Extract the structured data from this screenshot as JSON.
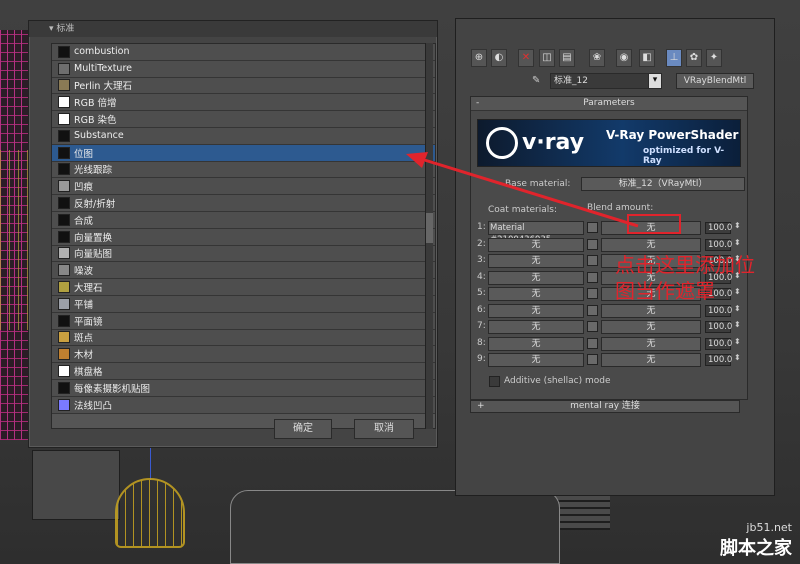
{
  "browser": {
    "title": "标准",
    "items": [
      {
        "label": "combustion",
        "thumb": "#111111"
      },
      {
        "label": "MultiTexture",
        "thumb": "#6e6e6e"
      },
      {
        "label": "Perlin 大理石",
        "thumb": "#8a7a55"
      },
      {
        "label": "RGB 倍增",
        "thumb": "#ffffff"
      },
      {
        "label": "RGB 染色",
        "thumb": "#ffffff"
      },
      {
        "label": "Substance",
        "thumb": "#111111"
      },
      {
        "label": "位图",
        "thumb": "#111111",
        "selected": true
      },
      {
        "label": "光线跟踪",
        "thumb": "#111111"
      },
      {
        "label": "凹痕",
        "thumb": "#9a9a9a"
      },
      {
        "label": "反射/折射",
        "thumb": "#111111"
      },
      {
        "label": "合成",
        "thumb": "#111111"
      },
      {
        "label": "向量置换",
        "thumb": "#111111"
      },
      {
        "label": "向量贴图",
        "thumb": "#b0b0b0"
      },
      {
        "label": "噪波",
        "thumb": "#888888"
      },
      {
        "label": "大理石",
        "thumb": "#b0a040"
      },
      {
        "label": "平铺",
        "thumb": "#9ca0a8"
      },
      {
        "label": "平面镜",
        "thumb": "#111111"
      },
      {
        "label": "斑点",
        "thumb": "#caa040"
      },
      {
        "label": "木材",
        "thumb": "#c08030"
      },
      {
        "label": "棋盘格",
        "thumb": "#ffffff"
      },
      {
        "label": "每像素摄影机贴图",
        "thumb": "#111111"
      },
      {
        "label": "法线凹凸",
        "thumb": "#7a7aff"
      }
    ],
    "ok_label": "确定",
    "cancel_label": "取消"
  },
  "material": {
    "name": "标准_12",
    "type_button": "VRayBlendMtl",
    "rollout_title": "Parameters",
    "vray_logo": "v·ray",
    "vray_title": "V-Ray PowerShader",
    "vray_sub": "optimized for V-Ray",
    "base_label": "Base material:",
    "base_value": "标准_12（VRayMtl）",
    "coat_header": "Coat materials:",
    "blend_header": "Blend amount:",
    "rows": [
      {
        "idx": "1:",
        "coat": "Material #2100436935",
        "blend": "无",
        "amount": "100.0"
      },
      {
        "idx": "2:",
        "coat": "无",
        "blend": "无",
        "amount": "100.0"
      },
      {
        "idx": "3:",
        "coat": "无",
        "blend": "无",
        "amount": "100.0"
      },
      {
        "idx": "4:",
        "coat": "无",
        "blend": "无",
        "amount": "100.0"
      },
      {
        "idx": "5:",
        "coat": "无",
        "blend": "无",
        "amount": "100.0"
      },
      {
        "idx": "6:",
        "coat": "无",
        "blend": "无",
        "amount": "100.0"
      },
      {
        "idx": "7:",
        "coat": "无",
        "blend": "无",
        "amount": "100.0"
      },
      {
        "idx": "8:",
        "coat": "无",
        "blend": "无",
        "amount": "100.0"
      },
      {
        "idx": "9:",
        "coat": "无",
        "blend": "无",
        "amount": "100.0"
      }
    ],
    "additive_label": "Additive (shellac) mode",
    "mental_ray_label": "mental ray 连接"
  },
  "annotation": {
    "line1": "点击这里添加位",
    "line2": "图当作遮罩",
    "color": "#e0242c"
  },
  "watermark": {
    "site": "jb51.net",
    "brand": "脚本之家"
  }
}
